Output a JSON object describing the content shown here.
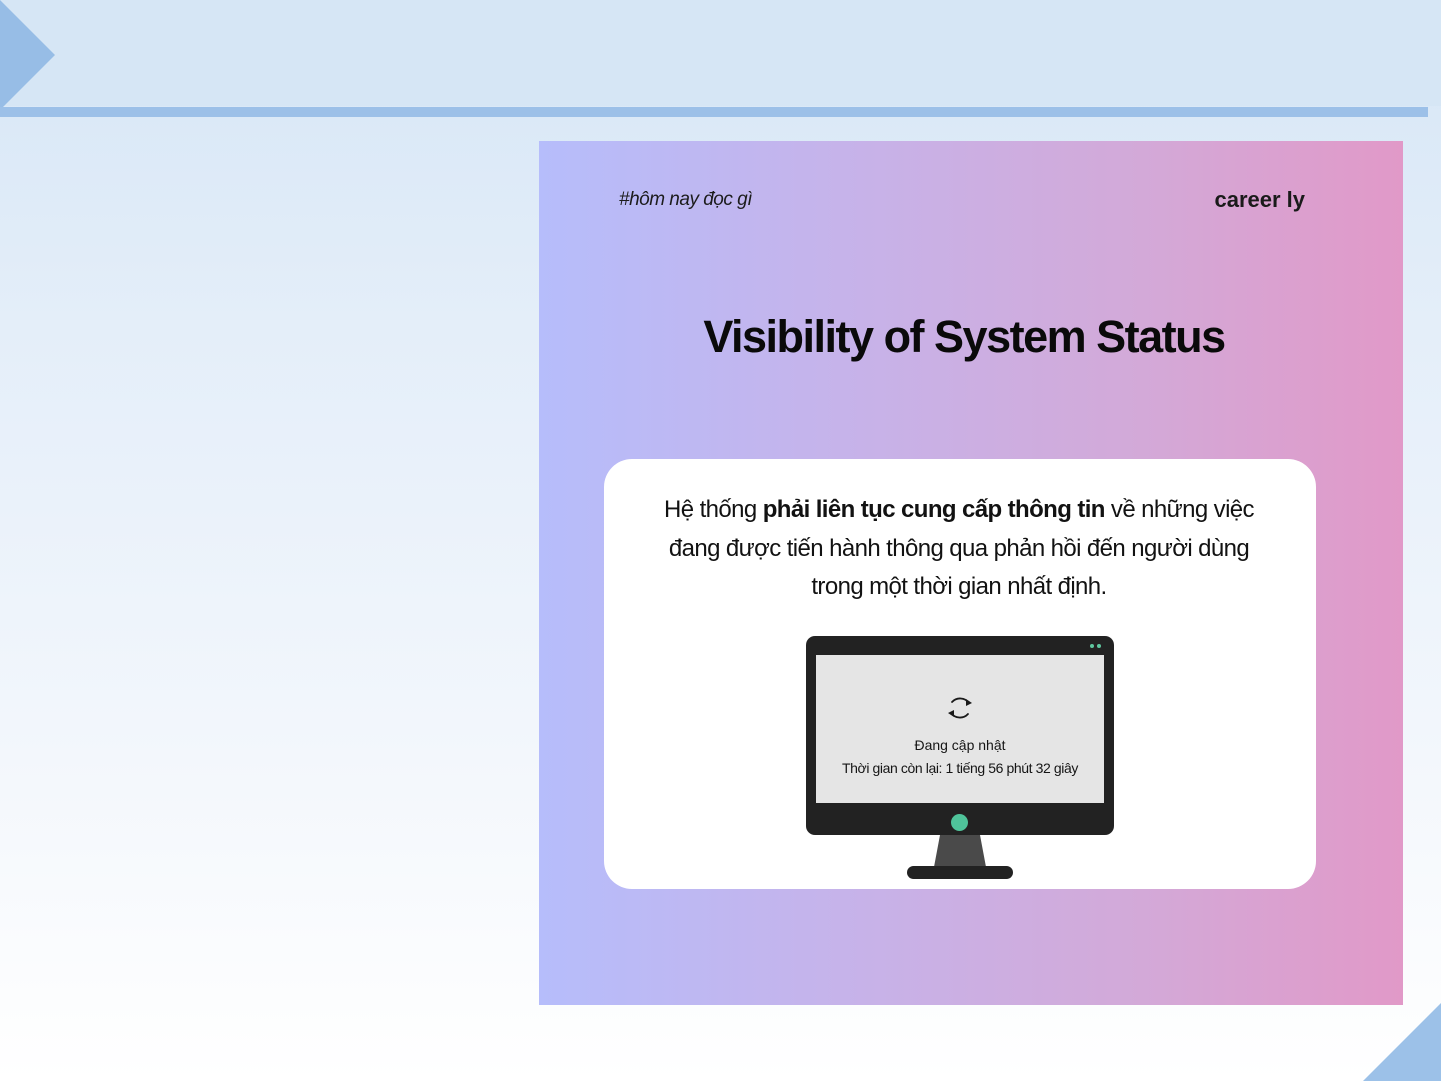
{
  "slide": {
    "hashtag": "#hôm nay đọc gì",
    "brand": "career ly",
    "title": "Visibility of System Status",
    "description": {
      "part1": "Hệ thống ",
      "bold": "phải liên tục cung cấp thông tin",
      "part2": " về những việc đang được tiến hành thông qua phản hồi đến người dùng trong một thời gian nhất định."
    },
    "monitor": {
      "status": "Đang cập nhật",
      "remaining": "Thời gian còn lại: 1 tiếng 56 phút 32 giây",
      "icon": "sync-icon"
    }
  },
  "colors": {
    "banner": "#d6e6f5",
    "accent": "#9cc0e8",
    "gradient_start": "#b6bdfb",
    "gradient_end": "#e199c8",
    "indicator": "#4fc39a"
  }
}
